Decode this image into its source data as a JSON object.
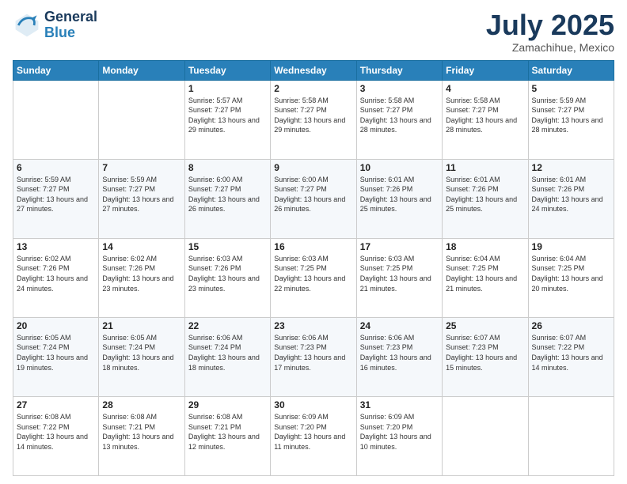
{
  "header": {
    "logo_general": "General",
    "logo_blue": "Blue",
    "main_title": "July 2025",
    "subtitle": "Zamachihue, Mexico"
  },
  "days_of_week": [
    "Sunday",
    "Monday",
    "Tuesday",
    "Wednesday",
    "Thursday",
    "Friday",
    "Saturday"
  ],
  "weeks": [
    [
      {
        "day": "",
        "info": ""
      },
      {
        "day": "",
        "info": ""
      },
      {
        "day": "1",
        "info": "Sunrise: 5:57 AM\nSunset: 7:27 PM\nDaylight: 13 hours and 29 minutes."
      },
      {
        "day": "2",
        "info": "Sunrise: 5:58 AM\nSunset: 7:27 PM\nDaylight: 13 hours and 29 minutes."
      },
      {
        "day": "3",
        "info": "Sunrise: 5:58 AM\nSunset: 7:27 PM\nDaylight: 13 hours and 28 minutes."
      },
      {
        "day": "4",
        "info": "Sunrise: 5:58 AM\nSunset: 7:27 PM\nDaylight: 13 hours and 28 minutes."
      },
      {
        "day": "5",
        "info": "Sunrise: 5:59 AM\nSunset: 7:27 PM\nDaylight: 13 hours and 28 minutes."
      }
    ],
    [
      {
        "day": "6",
        "info": "Sunrise: 5:59 AM\nSunset: 7:27 PM\nDaylight: 13 hours and 27 minutes."
      },
      {
        "day": "7",
        "info": "Sunrise: 5:59 AM\nSunset: 7:27 PM\nDaylight: 13 hours and 27 minutes."
      },
      {
        "day": "8",
        "info": "Sunrise: 6:00 AM\nSunset: 7:27 PM\nDaylight: 13 hours and 26 minutes."
      },
      {
        "day": "9",
        "info": "Sunrise: 6:00 AM\nSunset: 7:27 PM\nDaylight: 13 hours and 26 minutes."
      },
      {
        "day": "10",
        "info": "Sunrise: 6:01 AM\nSunset: 7:26 PM\nDaylight: 13 hours and 25 minutes."
      },
      {
        "day": "11",
        "info": "Sunrise: 6:01 AM\nSunset: 7:26 PM\nDaylight: 13 hours and 25 minutes."
      },
      {
        "day": "12",
        "info": "Sunrise: 6:01 AM\nSunset: 7:26 PM\nDaylight: 13 hours and 24 minutes."
      }
    ],
    [
      {
        "day": "13",
        "info": "Sunrise: 6:02 AM\nSunset: 7:26 PM\nDaylight: 13 hours and 24 minutes."
      },
      {
        "day": "14",
        "info": "Sunrise: 6:02 AM\nSunset: 7:26 PM\nDaylight: 13 hours and 23 minutes."
      },
      {
        "day": "15",
        "info": "Sunrise: 6:03 AM\nSunset: 7:26 PM\nDaylight: 13 hours and 23 minutes."
      },
      {
        "day": "16",
        "info": "Sunrise: 6:03 AM\nSunset: 7:25 PM\nDaylight: 13 hours and 22 minutes."
      },
      {
        "day": "17",
        "info": "Sunrise: 6:03 AM\nSunset: 7:25 PM\nDaylight: 13 hours and 21 minutes."
      },
      {
        "day": "18",
        "info": "Sunrise: 6:04 AM\nSunset: 7:25 PM\nDaylight: 13 hours and 21 minutes."
      },
      {
        "day": "19",
        "info": "Sunrise: 6:04 AM\nSunset: 7:25 PM\nDaylight: 13 hours and 20 minutes."
      }
    ],
    [
      {
        "day": "20",
        "info": "Sunrise: 6:05 AM\nSunset: 7:24 PM\nDaylight: 13 hours and 19 minutes."
      },
      {
        "day": "21",
        "info": "Sunrise: 6:05 AM\nSunset: 7:24 PM\nDaylight: 13 hours and 18 minutes."
      },
      {
        "day": "22",
        "info": "Sunrise: 6:06 AM\nSunset: 7:24 PM\nDaylight: 13 hours and 18 minutes."
      },
      {
        "day": "23",
        "info": "Sunrise: 6:06 AM\nSunset: 7:23 PM\nDaylight: 13 hours and 17 minutes."
      },
      {
        "day": "24",
        "info": "Sunrise: 6:06 AM\nSunset: 7:23 PM\nDaylight: 13 hours and 16 minutes."
      },
      {
        "day": "25",
        "info": "Sunrise: 6:07 AM\nSunset: 7:23 PM\nDaylight: 13 hours and 15 minutes."
      },
      {
        "day": "26",
        "info": "Sunrise: 6:07 AM\nSunset: 7:22 PM\nDaylight: 13 hours and 14 minutes."
      }
    ],
    [
      {
        "day": "27",
        "info": "Sunrise: 6:08 AM\nSunset: 7:22 PM\nDaylight: 13 hours and 14 minutes."
      },
      {
        "day": "28",
        "info": "Sunrise: 6:08 AM\nSunset: 7:21 PM\nDaylight: 13 hours and 13 minutes."
      },
      {
        "day": "29",
        "info": "Sunrise: 6:08 AM\nSunset: 7:21 PM\nDaylight: 13 hours and 12 minutes."
      },
      {
        "day": "30",
        "info": "Sunrise: 6:09 AM\nSunset: 7:20 PM\nDaylight: 13 hours and 11 minutes."
      },
      {
        "day": "31",
        "info": "Sunrise: 6:09 AM\nSunset: 7:20 PM\nDaylight: 13 hours and 10 minutes."
      },
      {
        "day": "",
        "info": ""
      },
      {
        "day": "",
        "info": ""
      }
    ]
  ]
}
